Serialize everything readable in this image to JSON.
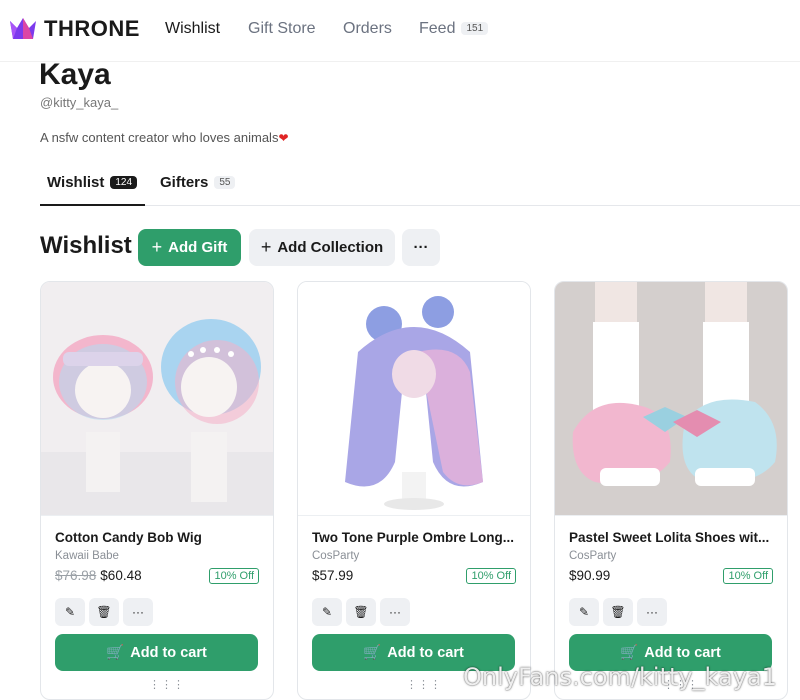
{
  "brand": {
    "name": "THRONE",
    "accent": "#2f9e6b"
  },
  "nav": {
    "items": [
      {
        "label": "Wishlist",
        "active": true
      },
      {
        "label": "Gift Store",
        "active": false
      },
      {
        "label": "Orders",
        "active": false
      },
      {
        "label": "Feed",
        "badge": "151",
        "active": false
      }
    ]
  },
  "profile": {
    "name": "Kaya",
    "handle": "@kitty_kaya_",
    "bio": "A nsfw content creator who loves animals",
    "bio_emoji": "❤"
  },
  "tabs": [
    {
      "label": "Wishlist",
      "count": "124",
      "active": true
    },
    {
      "label": "Gifters",
      "count": "55",
      "active": false
    }
  ],
  "wishlist": {
    "title": "Wishlist",
    "add_gift_label": "Add Gift",
    "add_collection_label": "Add Collection",
    "more_label": "···"
  },
  "items": [
    {
      "title": "Cotton Candy Bob Wig",
      "store": "Kawaii Babe",
      "old_price": "$76.98",
      "price": "$60.48",
      "discount": "10% Off",
      "cart_label": "Add to cart"
    },
    {
      "title": "Two Tone Purple Ombre Long...",
      "store": "CosParty",
      "price": "$57.99",
      "discount": "10% Off",
      "cart_label": "Add to cart"
    },
    {
      "title": "Pastel Sweet Lolita Shoes wit...",
      "store": "CosParty",
      "price": "$90.99",
      "discount": "10% Off",
      "cart_label": "Add to cart"
    }
  ],
  "icons": {
    "edit": "pencil-icon",
    "delete": "trash-icon",
    "more": "more-icon",
    "cart": "cart-icon",
    "drag": "drag-handle-icon"
  },
  "watermark": "OnlyFans.com/kitty_kaya1"
}
